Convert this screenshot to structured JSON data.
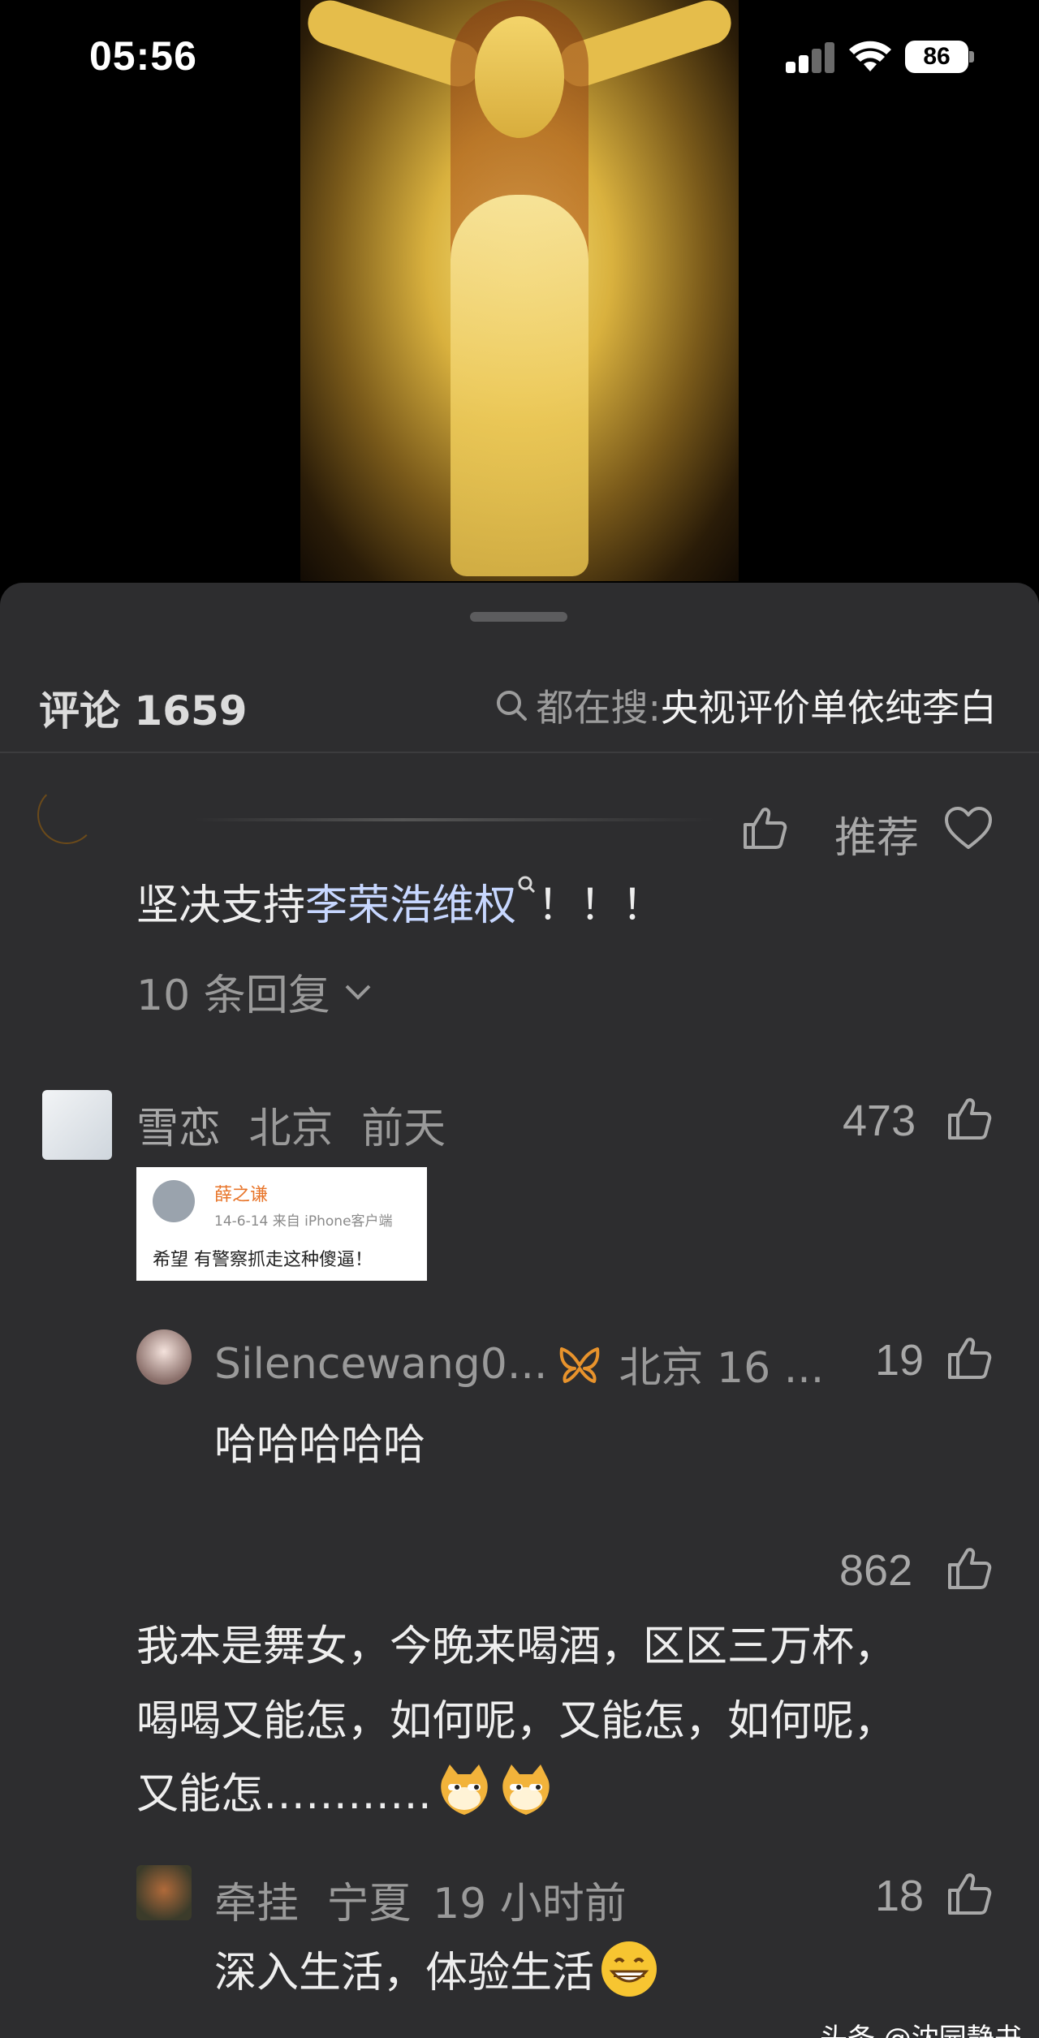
{
  "status_bar": {
    "time": "05:56",
    "battery": "86"
  },
  "video": {
    "description_icon": "video-frame"
  },
  "sheet": {
    "title": "评论 1659",
    "search_prefix": "都在搜: ",
    "search_term": "央视评价单依纯李白"
  },
  "comments": [
    {
      "recommend": "推荐",
      "text_prefix": "坚决支持",
      "text_link": "李荣浩维权",
      "text_suffix": "！！！",
      "replies_label": "10 条回复"
    },
    {
      "user": "雪恋",
      "location": "北京",
      "time": "前天",
      "likes": "473",
      "quote": {
        "name": "薛之谦",
        "meta": "14-6-14   来自 iPhone客户端",
        "text": "希望 有警察抓走这种傻逼！"
      },
      "reply": {
        "user": "Silencewang0...",
        "location": "北京 16 ...",
        "likes": "19",
        "text": "哈哈哈哈哈"
      }
    },
    {
      "likes": "862",
      "lines": [
        "我本是舞女，今晚来喝酒，区区三万杯，",
        "喝喝又能怎，如何呢，又能怎，如何呢，",
        "又能怎…………"
      ],
      "reply": {
        "user": "牵挂",
        "location": "宁夏",
        "time": "19 小时前",
        "likes": "18",
        "text": "深入生活，体验生活"
      }
    }
  ],
  "watermark": "头条 @沈园静书",
  "colors": {
    "sheet_bg": "#2d2d2f",
    "link": "#c7d7ff",
    "orange": "#e8932c"
  }
}
